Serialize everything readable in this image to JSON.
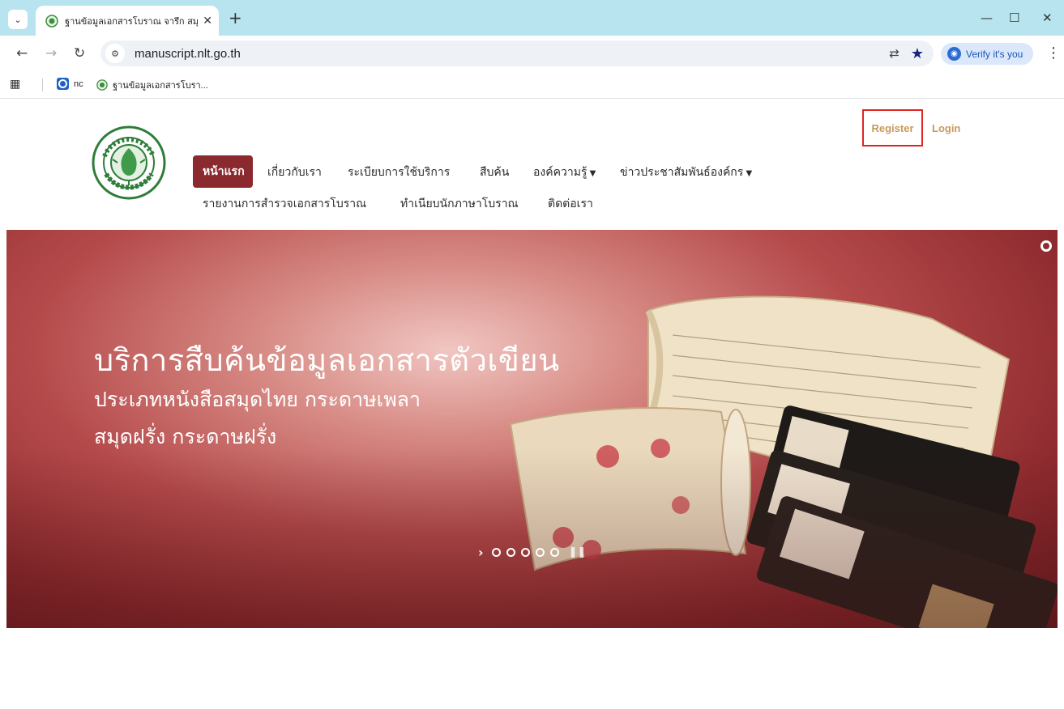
{
  "browser": {
    "tab_title": "ฐานข้อมูลเอกสารโบราณ จารึก สมุดไ",
    "new_tab": "+",
    "url": "manuscript.nlt.go.th",
    "verify_label": "Verify it's you",
    "bookmarks": [
      {
        "label": "nc"
      },
      {
        "label": "ฐานข้อมูลเอกสารโบรา..."
      }
    ]
  },
  "site": {
    "nav": {
      "home": "หน้าแรก",
      "about": "เกี่ยวกับเรา",
      "rules": "ระเบียบการใช้บริการ",
      "search": "สืบค้น",
      "knowledge": "องค์ความรู้",
      "news": "ข่าวประชาสัมพันธ์องค์กร",
      "survey": "รายงานการสำรวจเอกสารโบราณ",
      "registry": "ทำเนียบนักภาษาโบราณ",
      "contact": "ติดต่อเรา"
    },
    "auth": {
      "register": "Register",
      "login": "Login"
    },
    "hero": {
      "title": "บริการสืบค้นข้อมูลเอกสารตัวเขียน",
      "line1": "ประเภทหนังสือสมุดไทย กระดาษเพลา",
      "line2": "สมุดฝรั่ง กระดาษฝรั่ง",
      "slide_count": 5
    }
  },
  "colors": {
    "tabstrip": "#b7e4ef",
    "nav_active": "#8b2a2e",
    "auth_link": "#c79a5a",
    "register_outline": "#e02424",
    "hero_base": "#8f2b2f"
  }
}
